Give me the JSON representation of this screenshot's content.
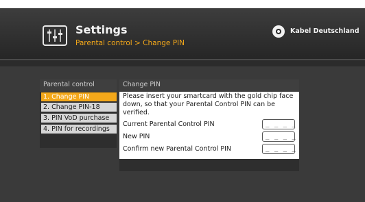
{
  "header": {
    "title": "Settings",
    "breadcrumb": "Parental control > Change PIN",
    "brand": "Kabel Deutschland",
    "icon": "settings-sliders-icon"
  },
  "menu": {
    "heading": "Parental control",
    "items": [
      {
        "label": "1. Change PIN",
        "active": true
      },
      {
        "label": "2. Change PIN-18",
        "active": false
      },
      {
        "label": "3. PIN VoD purchase",
        "active": false
      },
      {
        "label": "4. PIN for recordings",
        "active": false
      }
    ]
  },
  "content": {
    "heading": "Change PIN",
    "instruction": "Please insert your smartcard with the gold chip face down, so that your Parental Control PIN can be verified.",
    "fields": [
      {
        "label": "Current Parental Control PIN",
        "value": "_ _ _ _"
      },
      {
        "label": "New PIN",
        "value": "_ _ _ _"
      },
      {
        "label": "Confirm new Parental Control PIN",
        "value": "_ _ _ _"
      }
    ]
  },
  "colors": {
    "accent": "#f4a81a",
    "background": "#2b2b2b",
    "panel": "#2e2e2e",
    "menu_item": "#d6d6d6"
  }
}
